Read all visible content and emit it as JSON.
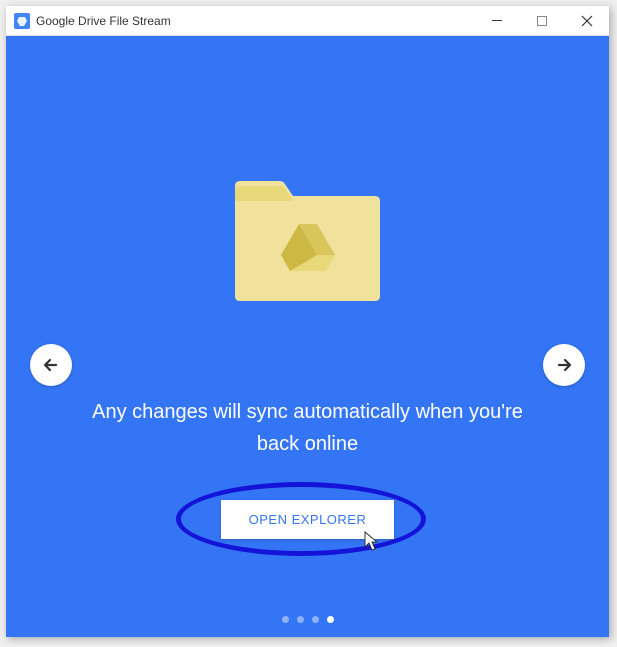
{
  "window": {
    "title": "Google Drive File Stream"
  },
  "content": {
    "message": "Any changes will sync automatically when you're back online",
    "button_label": "OPEN EXPLORER"
  },
  "pagination": {
    "total": 4,
    "active_index": 3
  }
}
